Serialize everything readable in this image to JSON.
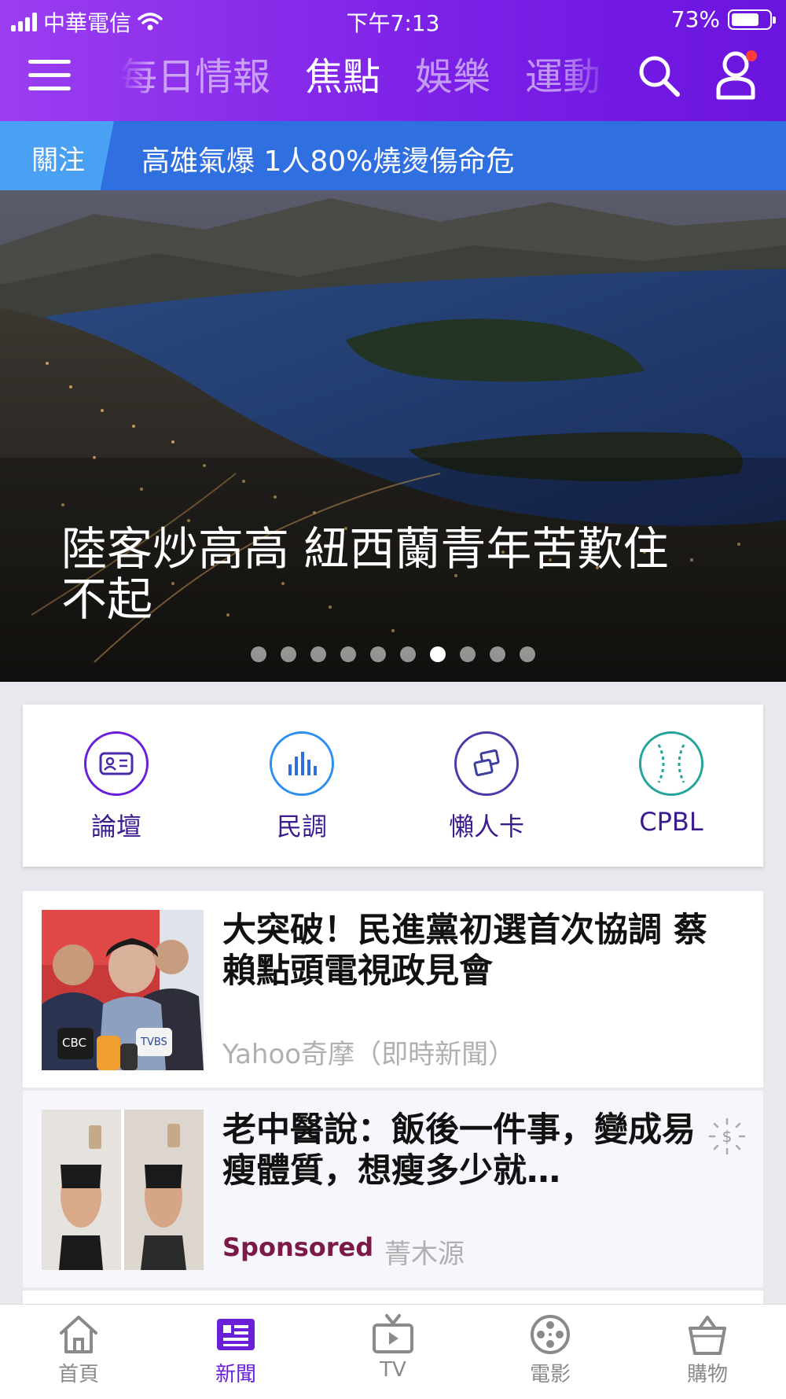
{
  "status_bar": {
    "carrier": "中華電信",
    "time": "下午7:13",
    "battery": "73%",
    "battery_level": 0.73
  },
  "header": {
    "tabs": [
      {
        "label": "每日情報"
      },
      {
        "label": "焦點"
      },
      {
        "label": "娛樂"
      },
      {
        "label": "運動"
      }
    ],
    "active_tab": "焦點"
  },
  "breaking": {
    "tag": "關注",
    "headline": "高雄氣爆 1人80%燒燙傷命危"
  },
  "hero": {
    "title": "陸客炒高高 紐西蘭青年苦歎住不起",
    "carousel_total": 10,
    "carousel_active": 7
  },
  "quick_links": [
    {
      "label": "論壇",
      "icon": "forum-icon",
      "color": "#6a1fd8"
    },
    {
      "label": "民調",
      "icon": "poll-icon",
      "color": "#2f8ff0"
    },
    {
      "label": "懶人卡",
      "icon": "cards-icon",
      "color": "#4b3aa8"
    },
    {
      "label": "CPBL",
      "icon": "baseball-icon",
      "color": "#24a39a"
    }
  ],
  "news": [
    {
      "headline": "大突破！民進黨初選首次協調 蔡賴點頭電視政見會",
      "source": "Yahoo奇摩（即時新聞）"
    },
    {
      "headline": "老中醫說：飯後一件事，變成易瘦體質，想瘦多少就…",
      "sponsored_label": "Sponsored",
      "source": "菁木源"
    }
  ],
  "bottom_nav": [
    {
      "label": "首頁",
      "icon": "home-icon"
    },
    {
      "label": "新聞",
      "icon": "news-icon",
      "active": true
    },
    {
      "label": "TV",
      "icon": "tv-icon"
    },
    {
      "label": "電影",
      "icon": "film-reel-icon"
    },
    {
      "label": "購物",
      "icon": "shopping-bag-icon"
    }
  ],
  "colors": {
    "header": "#7a1fe6",
    "breaking_bar": "#2f6fe0",
    "accent": "#6a1fd8",
    "sponsored": "#7a1a45"
  }
}
